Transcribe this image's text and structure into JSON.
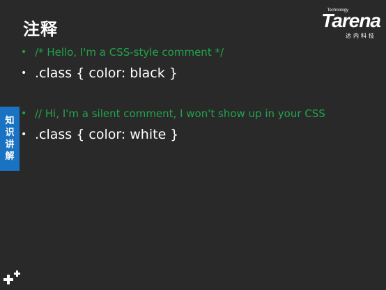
{
  "slide": {
    "title": "注释",
    "logo": {
      "brand": "Tarena",
      "tagline": "Technology",
      "cn": "达内科技"
    },
    "side_tab": [
      "知",
      "识",
      "讲",
      "解"
    ],
    "bullets": [
      {
        "text": "/* Hello, I'm a CSS-style comment */",
        "style": "comment"
      },
      {
        "text": ".class { color: black }",
        "style": "code"
      },
      {
        "text": "// Hi, I'm a silent comment, I won't show up in your CSS",
        "style": "comment"
      },
      {
        "text": ".class { color: white }",
        "style": "code"
      }
    ],
    "colors": {
      "background": "#2a2929",
      "comment": "#1fa54a",
      "code": "#ffffff",
      "tab": "#1a73c2"
    },
    "decor_icon": "plus-cluster-icon"
  }
}
